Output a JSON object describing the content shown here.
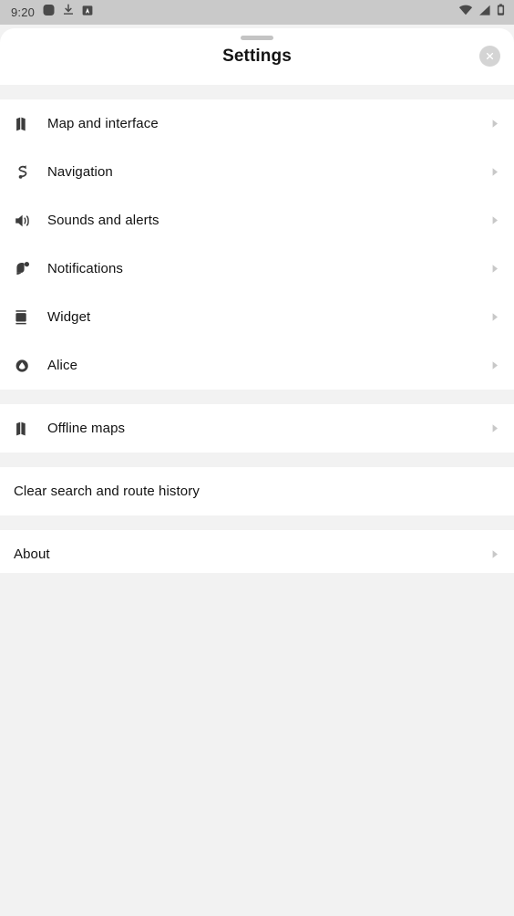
{
  "status_bar": {
    "clock": "9:20",
    "left_icons": [
      "rounded-square-app-icon",
      "download-icon",
      "android-auto-badge-icon"
    ],
    "right_icons": [
      "wifi-icon",
      "cellular-signal-icon",
      "battery-icon"
    ]
  },
  "sheet": {
    "title": "Settings",
    "close_label": "×",
    "grabber": "drag-handle"
  },
  "groups": [
    {
      "id": "main",
      "items": [
        {
          "label": "Map and interface",
          "icon": "map-icon",
          "chevron": true
        },
        {
          "label": "Navigation",
          "icon": "navigation-route-icon",
          "chevron": true
        },
        {
          "label": "Sounds and alerts",
          "icon": "speaker-icon",
          "chevron": true
        },
        {
          "label": "Notifications",
          "icon": "bell-icon",
          "chevron": true
        },
        {
          "label": "Widget",
          "icon": "widget-icon",
          "chevron": true
        },
        {
          "label": "Alice",
          "icon": "alice-assistant-icon",
          "chevron": true
        }
      ]
    },
    {
      "id": "offline",
      "items": [
        {
          "label": "Offline maps",
          "icon": "map-icon",
          "chevron": true
        }
      ]
    },
    {
      "id": "history",
      "items": [
        {
          "label": "Clear search and route history",
          "icon": null,
          "chevron": false
        }
      ]
    },
    {
      "id": "about",
      "items": [
        {
          "label": "About",
          "icon": null,
          "chevron": true
        }
      ]
    }
  ],
  "colors": {
    "sheet_background": "#ffffff",
    "page_background": "#f2f2f2",
    "status_bar_background": "#c9c9c9",
    "text_primary": "#121212",
    "icon": "#3c3c3c",
    "chevron": "#c8c8c8",
    "close_button": "#d4d4d4"
  }
}
